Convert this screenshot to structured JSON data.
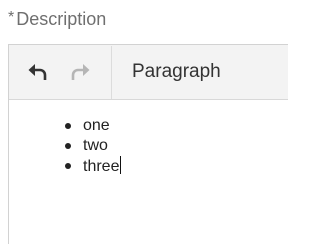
{
  "field": {
    "required_marker": "*",
    "label": "Description"
  },
  "toolbar": {
    "undo_icon": "undo-arrow",
    "redo_icon": "redo-arrow",
    "block_format": "Paragraph",
    "colors": {
      "undo_enabled": "#333333",
      "redo_disabled": "#b5b5b5",
      "toolbar_bg": "#f3f3f3"
    }
  },
  "content": {
    "list_items": [
      "one",
      "two",
      "three"
    ]
  }
}
